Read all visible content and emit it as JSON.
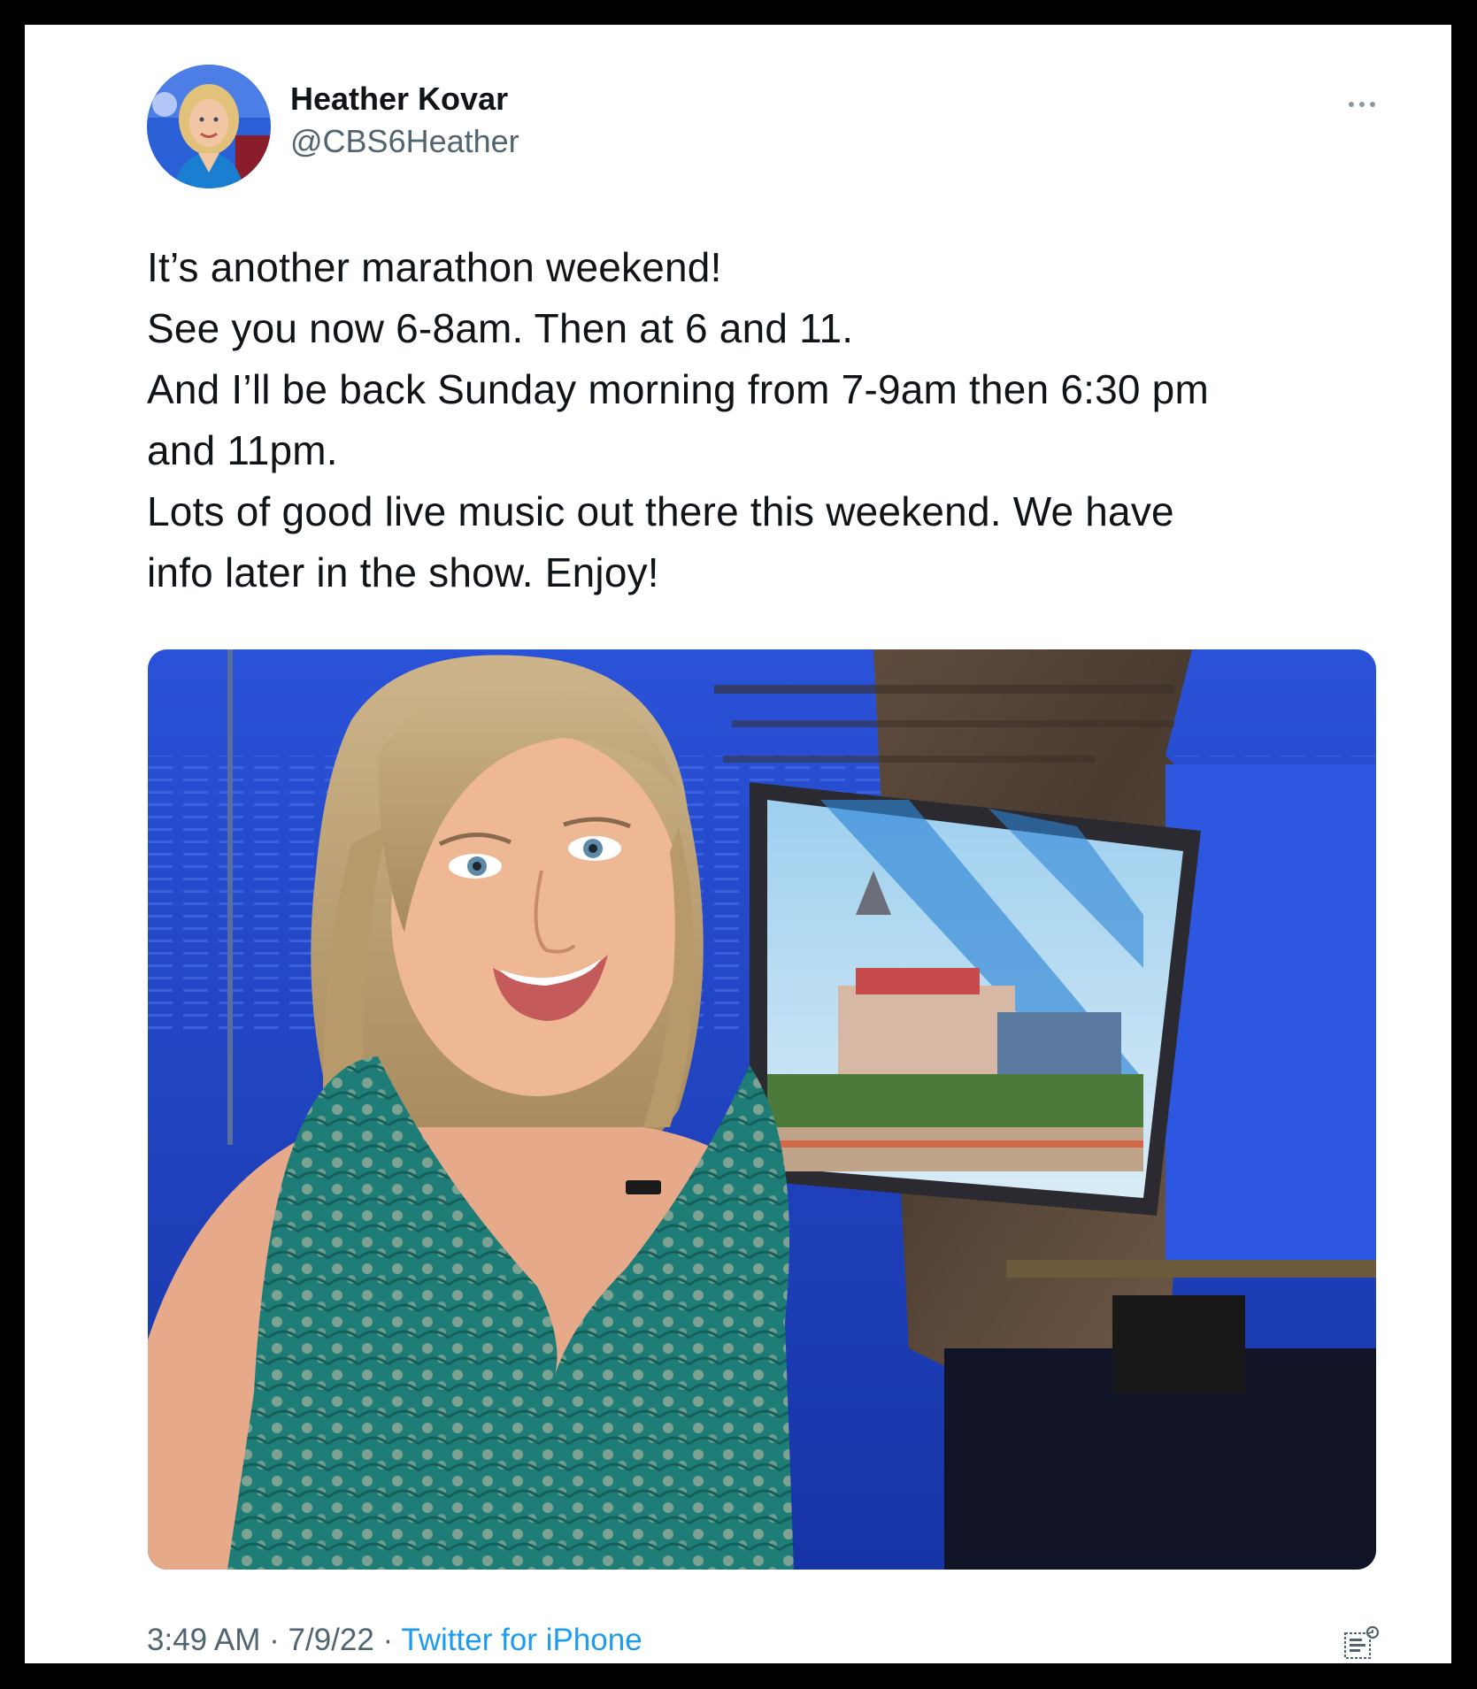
{
  "author": {
    "display_name": "Heather Kovar",
    "handle": "@CBS6Heather"
  },
  "tweet": {
    "text": "It’s another marathon weekend!\nSee you now 6-8am. Then at 6 and 11.\nAnd I’ll be back Sunday morning from 7-9am then 6:30 pm\nand 11pm.\nLots of good live music out there this weekend. We have\ninfo later in the show. Enjoy!"
  },
  "footer": {
    "time": "3:49 AM",
    "separator": " · ",
    "date": "7/9/22",
    "source": "Twitter for iPhone"
  },
  "icons": {
    "more": "more-horizontal-icon",
    "analytics": "analytics-icon"
  },
  "colors": {
    "text_primary": "#0f1419",
    "text_secondary": "#536471",
    "link": "#1d9bf0",
    "studio_blue": "#1f47c9"
  }
}
